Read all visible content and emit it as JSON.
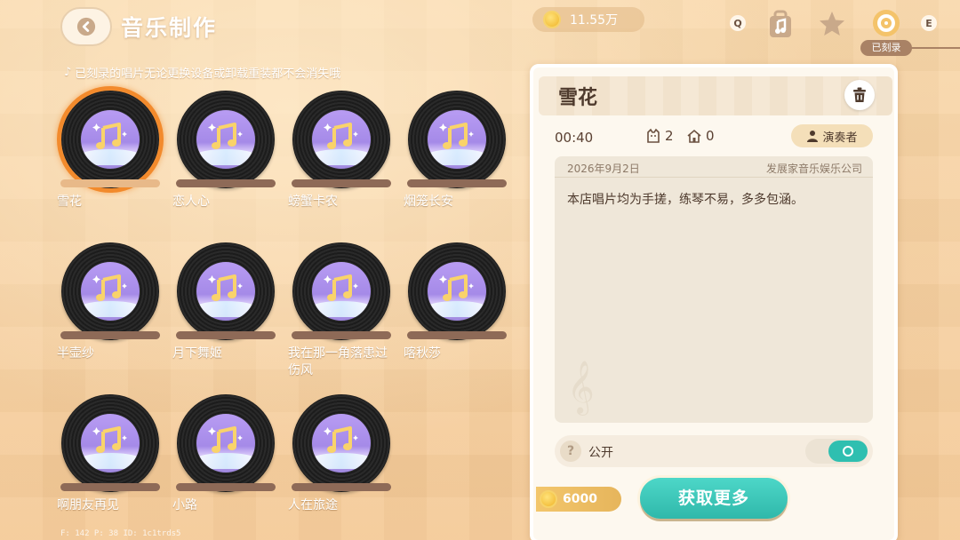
{
  "header": {
    "title": "音乐制作",
    "notice": "已刻录的唱片无论更换设备或卸载重装都不会消失哦"
  },
  "currency": {
    "amount": "11.55万"
  },
  "top_icons": {
    "key_left": "Q",
    "key_right": "E",
    "recorded_tab_label": "已刻录"
  },
  "records": [
    {
      "name": "雪花",
      "selected": true
    },
    {
      "name": "恋人心"
    },
    {
      "name": "螃蟹卡农"
    },
    {
      "name": "烟笼长安"
    },
    {
      "name": "半壶纱"
    },
    {
      "name": "月下舞姬"
    },
    {
      "name": "我在那一角落患过伤风"
    },
    {
      "name": "喀秋莎"
    },
    {
      "name": "啊朋友再见"
    },
    {
      "name": "小路"
    },
    {
      "name": "人在旅途"
    }
  ],
  "debug": "F: 142   P: 38   ID: 1c1trds5",
  "detail": {
    "title": "雪花",
    "duration": "00:40",
    "stat_a": "2",
    "stat_b": "0",
    "performer_label": "演奏者",
    "date": "2026年9月2日",
    "company": "发展家音乐娱乐公司",
    "description": "本店唱片均为手搓，练琴不易，多多包涵。",
    "public_label": "公开",
    "public_on": true,
    "price": "6000",
    "get_more_label": "获取更多"
  },
  "colors": {
    "accent": "#2fbfb0",
    "selected_ring": "#f28a2c"
  }
}
